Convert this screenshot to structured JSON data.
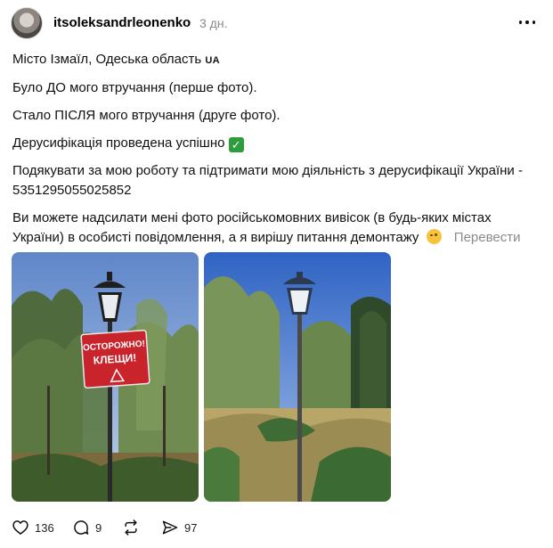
{
  "post": {
    "username": "itsoleksandrleonenko",
    "timestamp": "3 дн.",
    "line1_text": "Місто Ізмаїл, Одеська область",
    "line1_flag": "UA",
    "line2": "Було ДО мого втручання (перше фото).",
    "line3": "Стало ПІСЛЯ мого втручання (друге фото).",
    "line4_text": "Дерусифікація проведена успішно",
    "line5": "Подякувати за мою роботу та підтримати мою діяльність з дерусифікації України - 5351295055025852",
    "line6": "Ви можете надсилати мені фото російськомовних вивісок (в будь-яких містах України) в особисті повідомлення, а я вирішу питання демонтажу",
    "translate_label": "Перевести",
    "sign_line1": "ОСТОРОЖНО!",
    "sign_line2": "КЛЕЩИ!"
  },
  "actions": {
    "likes": "136",
    "comments": "9",
    "shares": "97"
  },
  "icons": [
    "avatar",
    "more-icon",
    "check-emoji-icon",
    "wink-emoji-icon",
    "heart-icon",
    "comment-icon",
    "repost-icon",
    "share-icon"
  ],
  "colors": {
    "secondary_text": "#8a8a8a",
    "sign_red": "#c9232b",
    "check_green": "#2e9d3c"
  }
}
